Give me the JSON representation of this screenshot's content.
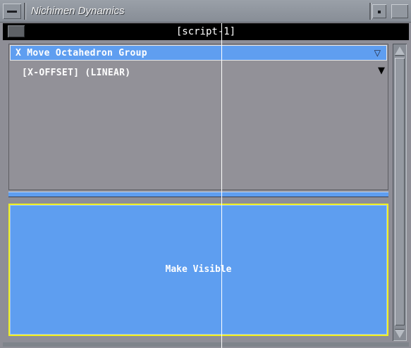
{
  "window": {
    "title": "Nichimen Dynamics"
  },
  "header": {
    "title": "[script-1]"
  },
  "list": {
    "group": {
      "label": "X Move Octahedron Group",
      "expanded": true
    },
    "items": [
      {
        "label": "[X-OFFSET] (LINEAR)"
      }
    ]
  },
  "action": {
    "label": "Make Visible"
  },
  "icons": {
    "window_menu": "window-menu-icon",
    "minimize": "minimize-icon",
    "maximize": "maximize-icon",
    "group_toggle": "triangle-down-outline-icon",
    "item_toggle": "triangle-down-filled-icon"
  },
  "colors": {
    "accent_blue": "#5f9ef0",
    "focus_yellow": "#f0f020",
    "panel_gray": "#929198",
    "header_black": "#000000"
  }
}
